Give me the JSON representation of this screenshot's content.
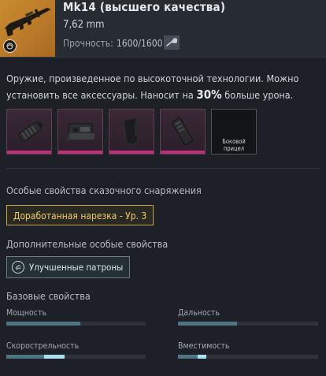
{
  "item": {
    "name": "Mk14 (высшего качества)",
    "caliber": "7,62 mm",
    "durability_label": "Прочность:",
    "durability_value": "1600/1600",
    "icon": "wrench-icon"
  },
  "description": {
    "part1": "Оружие, произведенное по высокоточной технологии. Можно установить все аксессуары. Наносит на ",
    "percent": "30%",
    "part2": " больше урона."
  },
  "attachments": [
    {
      "name": "muzzle",
      "filled": true
    },
    {
      "name": "scope-mount",
      "filled": true
    },
    {
      "name": "stock",
      "filled": true
    },
    {
      "name": "magazine",
      "filled": true
    },
    {
      "name": "side-sight",
      "filled": false,
      "label": "Боковой прицел"
    }
  ],
  "sections": {
    "legendary": "Особые свойства сказочного снаряжения",
    "additional": "Дополнительные особые свойства",
    "base": "Базовые свойства"
  },
  "perks": {
    "legendary": "Доработанная нарезка - Ур. 3",
    "additional": "Улучшенные патроны"
  },
  "stats": [
    {
      "label": "Мощность",
      "value": 0.53,
      "bonus": 0
    },
    {
      "label": "Дальность",
      "value": 0.42,
      "bonus": 0
    },
    {
      "label": "Скорострельность",
      "value": 0.27,
      "bonus": 0.15
    },
    {
      "label": "Вместимость",
      "value": 0.14,
      "bonus": 0.06
    }
  ],
  "colors": {
    "accent_gold": "#f0cc6a",
    "accent_magenta": "#c0307a",
    "stat_fill": "#4f7585",
    "stat_bonus": "#a9dff0"
  }
}
